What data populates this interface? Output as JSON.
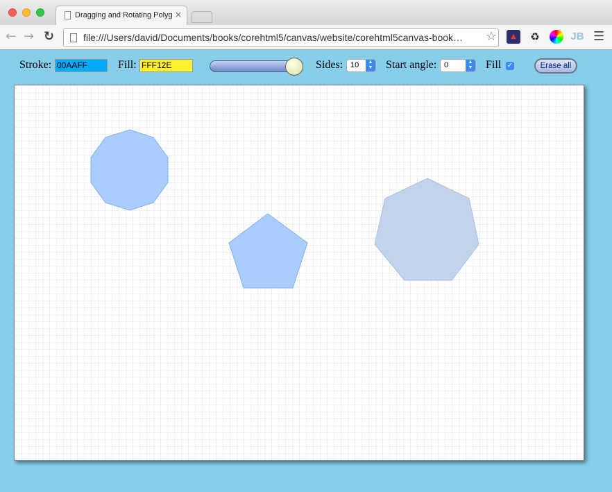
{
  "browser": {
    "tab_title": "Dragging and Rotating Polygons",
    "tab_close": "×",
    "url": "file:///Users/david/Documents/books/corehtml5/canvas/website/corehtml5canvas-book…",
    "ext_jb": "JB"
  },
  "controls": {
    "stroke_label": "Stroke:",
    "stroke_value": "00AAFF",
    "fill_label": "Fill:",
    "fill_value": "FFF12E",
    "slider_value": 1.0,
    "sides_label": "Sides:",
    "sides_value": "10",
    "start_angle_label": "Start angle:",
    "start_angle_value": "0",
    "fill_checkbox_label": "Fill",
    "fill_checked": true,
    "erase_label": "Erase all"
  },
  "colors": {
    "background": "#87ceeb",
    "stroke_field_bg": "#00aaff",
    "fill_field_bg": "#fff12e",
    "polygon_fill": "#aaccff",
    "polygon_stroke": "#7fb2e8",
    "rotated_polygon_fill": "#c2d3ec",
    "grid": "#e0e0e0"
  },
  "polygons": [
    {
      "name": "decagon",
      "sides": 10
    },
    {
      "name": "pentagon",
      "sides": 5
    },
    {
      "name": "heptagon",
      "sides": 7,
      "rotated": true
    }
  ]
}
